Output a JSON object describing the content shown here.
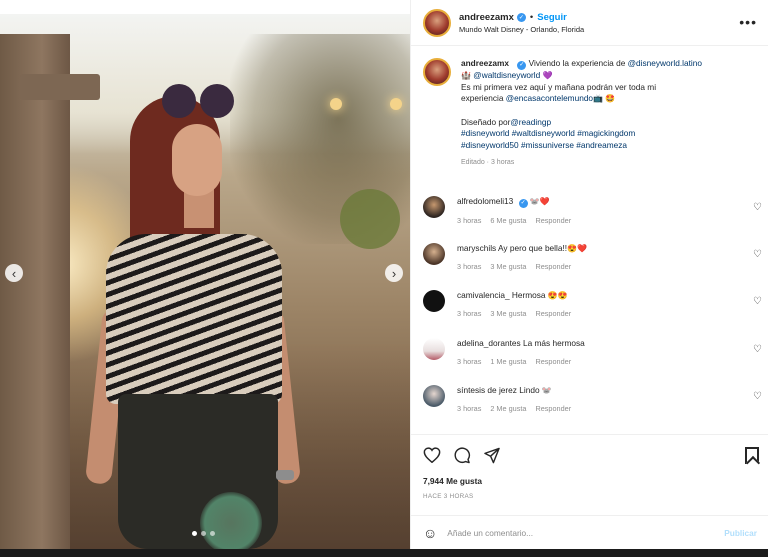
{
  "post": {
    "username": "andreezamx",
    "follow_label": "Seguir",
    "separator": "•",
    "location": "Mundo Walt Disney - Orlando, Florida",
    "more_icon": "more-horizontal-icon"
  },
  "caption": {
    "username": "andreezamx",
    "line1_prefix": "Viviendo la experiencia de ",
    "mention_disney_latino": "@disneyworld.latino",
    "line2_emoji_castle": "🏰",
    "mention_wdw": "@waltdisneyworld",
    "emoji_heart": "💜",
    "line3": "Es mi primera vez aquí y mañana podrán ver toda mi",
    "line4_prefix": "experiencia ",
    "mention_encasa": "@encasacontelemundo",
    "emoji_tv": "📺",
    "emoji_face": "🤩",
    "designed_prefix": "Diseñado por",
    "mention_reading": "@readingp",
    "hashtags_line1": "#disneyworld #waltdisneyworld #magickingdom",
    "hashtags_line2": "#disneyworld50 #missuniverse #andreameza",
    "meta": "Editado · 3 horas"
  },
  "comments": [
    {
      "username": "alfredolomeli13",
      "text": "",
      "emoji": "🐭❤️",
      "time": "3 horas",
      "likes": "6 Me gusta",
      "reply": "Responder",
      "verified": true
    },
    {
      "username": "maryschils",
      "text": "Ay pero que bella!!",
      "emoji": "😍❤️",
      "time": "3 horas",
      "likes": "3 Me gusta",
      "reply": "Responder",
      "verified": false
    },
    {
      "username": "camivalencia_",
      "text": "Hermosa",
      "emoji": "😍😍",
      "time": "3 horas",
      "likes": "3 Me gusta",
      "reply": "Responder",
      "verified": false
    },
    {
      "username": "adelina_dorantes",
      "text": "La más hermosa",
      "emoji": "",
      "time": "3 horas",
      "likes": "1 Me gusta",
      "reply": "Responder",
      "verified": false
    },
    {
      "username": "síntesis de jerez",
      "text": "Lindo",
      "emoji": "🐭",
      "time": "3 horas",
      "likes": "2 Me gusta",
      "reply": "Responder",
      "verified": false
    }
  ],
  "actions": {
    "likes": "7,944 Me gusta",
    "time_ago": "HACE 3 HORAS"
  },
  "comment_box": {
    "placeholder": "Añade un comentario...",
    "publish_label": "Publicar"
  },
  "carousel": {
    "slide_count": 3,
    "active_index": 0
  },
  "colors": {
    "link": "#00376b",
    "follow": "#0095f6",
    "verified": "#3897f0",
    "muted": "#8e8e8e",
    "publish_disabled": "#b2dffc"
  }
}
